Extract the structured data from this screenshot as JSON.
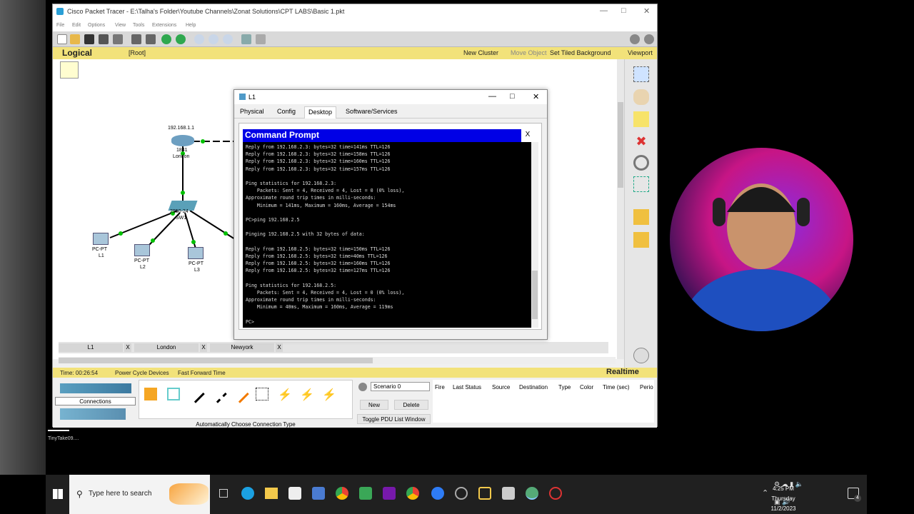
{
  "pt_window": {
    "title": "Cisco Packet Tracer - E:\\Talha's Folder\\Youtube Channels\\Zonat Solutions\\CPT LABS\\Basic 1.pkt",
    "menu": [
      "File",
      "Edit",
      "Options",
      "View",
      "Tools",
      "Extensions",
      "Help"
    ],
    "nav": {
      "mode": "Logical",
      "root": "[Root]",
      "new_cluster": "New Cluster",
      "move_object": "Move Object",
      "set_tiled_bg": "Set Tiled Background",
      "viewport": "Viewport"
    },
    "topology": {
      "router": {
        "ip": "192.168.1.1",
        "model": "1841",
        "name": "London"
      },
      "switch": {
        "model": "2950-24",
        "name": "SW1"
      },
      "pcs": [
        {
          "type": "PC-PT",
          "name": "L1"
        },
        {
          "type": "PC-PT",
          "name": "L2"
        },
        {
          "type": "PC-PT",
          "name": "L3"
        }
      ]
    },
    "open_tabs": [
      "L1",
      "London",
      "Newyork"
    ],
    "tab_close": "X",
    "status": {
      "time": "Time: 00:26:54",
      "power_cycle": "Power Cycle Devices",
      "fast_forward": "Fast Forward Time",
      "mode": "Realtime"
    },
    "bottom": {
      "connections_label": "Connections",
      "auto_conn": "Automatically Choose Connection Type",
      "scenario": "Scenario 0",
      "new_btn": "New",
      "delete_btn": "Delete",
      "toggle_pdu": "Toggle PDU List Window",
      "pdu_columns": [
        "Fire",
        "Last Status",
        "Source",
        "Destination",
        "Type",
        "Color",
        "Time (sec)",
        "Perio"
      ]
    }
  },
  "l1_window": {
    "title": "L1",
    "tabs": [
      "Physical",
      "Config",
      "Desktop",
      "Software/Services"
    ],
    "active_tab": "Desktop",
    "cmd_title": "Command Prompt",
    "cmd_close": "X",
    "terminal": "Reply from 192.168.2.3: bytes=32 time=141ms TTL=126\nReply from 192.168.2.3: bytes=32 time=158ms TTL=126\nReply from 192.168.2.3: bytes=32 time=160ms TTL=126\nReply from 192.168.2.3: bytes=32 time=157ms TTL=126\n\nPing statistics for 192.168.2.3:\n    Packets: Sent = 4, Received = 4, Lost = 0 (0% loss),\nApproximate round trip times in milli-seconds:\n    Minimum = 141ms, Maximum = 160ms, Average = 154ms\n\nPC>ping 192.168.2.5\n\nPinging 192.168.2.5 with 32 bytes of data:\n\nReply from 192.168.2.5: bytes=32 time=150ms TTL=126\nReply from 192.168.2.5: bytes=32 time=40ms TTL=126\nReply from 192.168.2.5: bytes=32 time=160ms TTL=126\nReply from 192.168.2.5: bytes=32 time=127ms TTL=126\n\nPing statistics for 192.168.2.5:\n    Packets: Sent = 4, Received = 4, Lost = 0 (0% loss),\nApproximate round trip times in milli-seconds:\n    Minimum = 40ms, Maximum = 160ms, Average = 119ms\n\nPC>"
  },
  "desktop": {
    "tinytake_label": "TinyTake09....",
    "search_placeholder": "Type here to search",
    "clock_time": "4:25 PM",
    "clock_day": "Thursday",
    "clock_date": "11/2/2023",
    "notification_count": "4"
  },
  "colors": {
    "nav_bar": "#f2e27a",
    "cmd_header": "#0000e6",
    "link_green": "#00c000",
    "link_black": "#000000"
  }
}
